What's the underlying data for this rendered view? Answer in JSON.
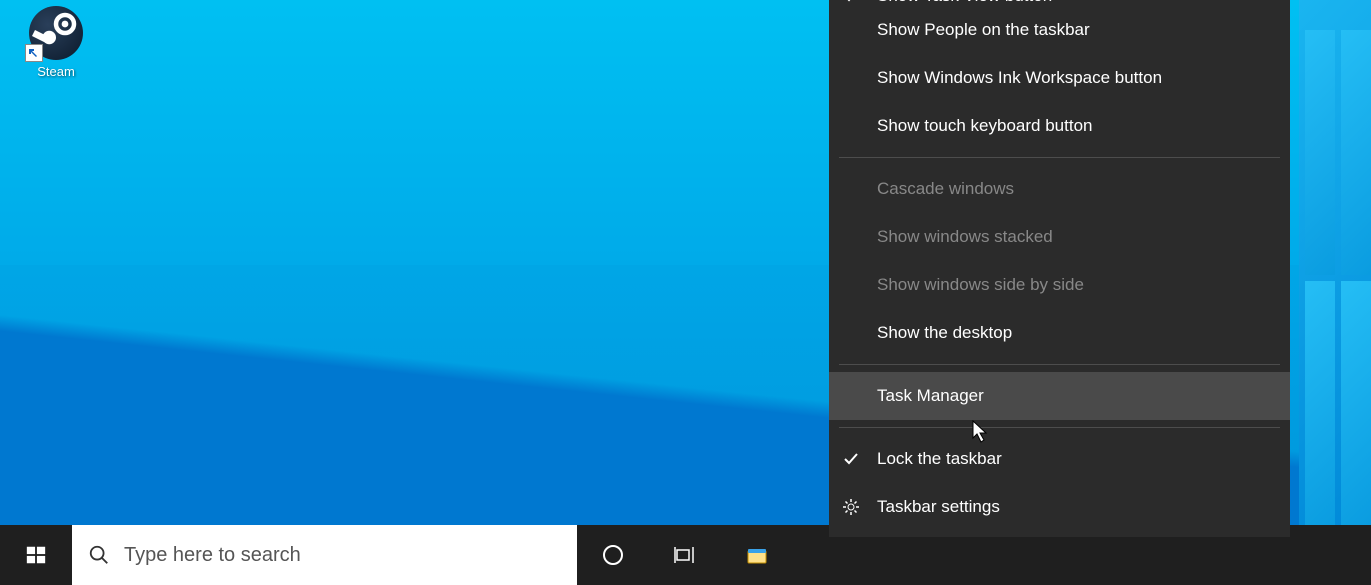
{
  "desktop": {
    "icons": [
      {
        "label": "Steam"
      }
    ]
  },
  "taskbar": {
    "search_placeholder": "Type here to search"
  },
  "context_menu": {
    "items": [
      {
        "label": "Show Task View button",
        "checked": true,
        "clipped": true
      },
      {
        "label": "Show People on the taskbar"
      },
      {
        "label": "Show Windows Ink Workspace button"
      },
      {
        "label": "Show touch keyboard button"
      },
      {
        "sep": true
      },
      {
        "label": "Cascade windows",
        "disabled": true
      },
      {
        "label": "Show windows stacked",
        "disabled": true
      },
      {
        "label": "Show windows side by side",
        "disabled": true
      },
      {
        "label": "Show the desktop"
      },
      {
        "sep": true
      },
      {
        "label": "Task Manager",
        "hover": true
      },
      {
        "sep": true
      },
      {
        "label": "Lock the taskbar",
        "checked": true
      },
      {
        "label": "Taskbar settings",
        "icon": "gear"
      }
    ]
  }
}
